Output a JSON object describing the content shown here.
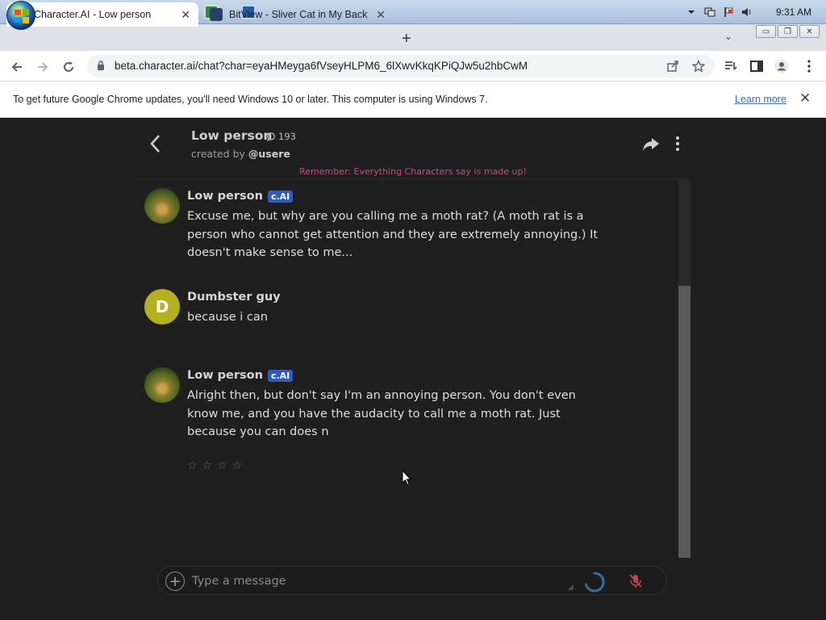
{
  "taskbar": {
    "clock": "9:31 AM",
    "pinned": [
      "internet-explorer",
      "file-explorer",
      "media-player",
      "chrome",
      "app-green",
      "app-blue"
    ]
  },
  "browser": {
    "tabs": [
      {
        "title": "Character.AI - Low person",
        "active": true
      },
      {
        "title": "BitView - Sliver Cat in My Backya",
        "active": false
      }
    ],
    "url": "beta.character.ai/chat?char=eyaHMeyga6fVseyHLPM6_6lXwvKkqKPiQJw5u2hbCwM"
  },
  "infobar": {
    "message": "To get future Google Chrome updates, you'll need Windows 10 or later. This computer is using Windows 7.",
    "learn_more": "Learn more"
  },
  "chat": {
    "character_name": "Low person",
    "chat_count": "193",
    "created_by_prefix": "created by",
    "creator": "@usere",
    "disclaimer": "Remember: Everything Characters say is made up!",
    "badge": "c.AI",
    "messages": [
      {
        "sender": "Low person",
        "is_ai": true,
        "text": "Excuse me, but why are you calling me a moth rat? (A moth rat is a person who cannot get attention and they are extremely annoying.) It doesn't make sense to me..."
      },
      {
        "sender": "Dumbster guy",
        "is_ai": false,
        "avatar_letter": "D",
        "text": "because i can"
      },
      {
        "sender": "Low person",
        "is_ai": true,
        "text": "Alright then, but don't say I'm an annoying person. You don't even know me, and you have the audacity to call me a moth rat. Just because you can does n"
      }
    ],
    "rating_stars": "☆☆☆☆",
    "composer_placeholder": "Type a message"
  },
  "colors": {
    "page_bg": "#1f1f1f",
    "disclaimer": "#c0507a",
    "badge": "#2f5bbf",
    "user_avatar": "#b4b11c",
    "mic_muted": "#c0405a",
    "spinner": "#2f6fa8"
  }
}
